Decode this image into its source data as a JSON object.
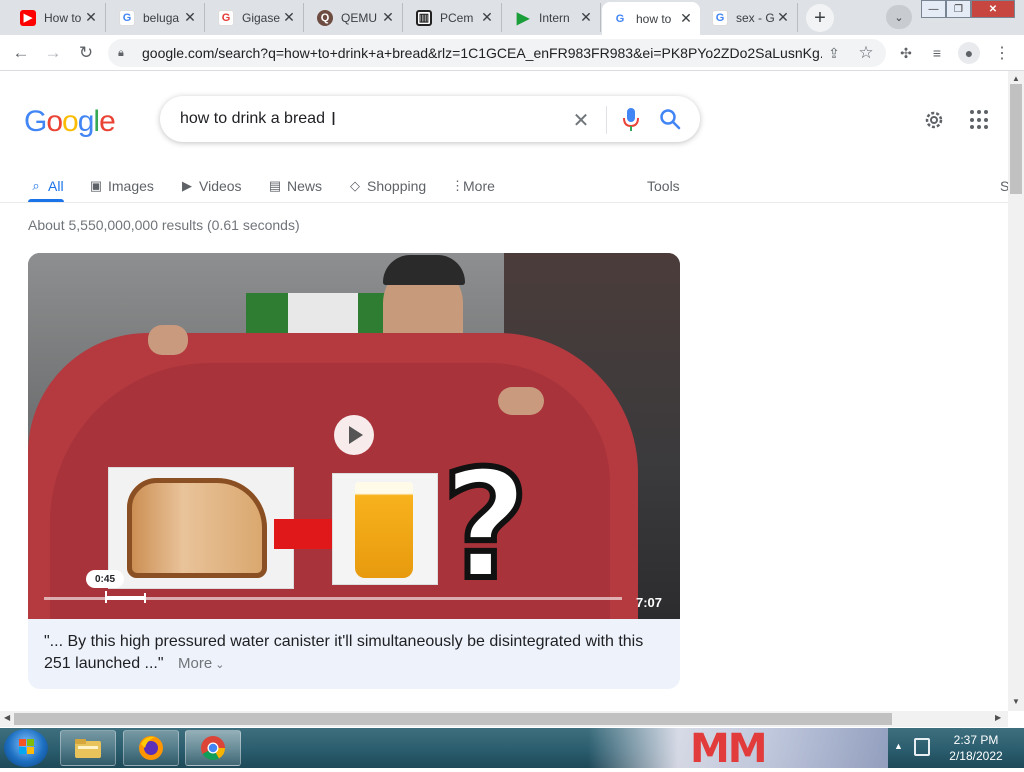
{
  "browser": {
    "tabs": [
      {
        "title": "How to",
        "favicon": "youtube-icon",
        "color": "#ff0000"
      },
      {
        "title": "beluga",
        "favicon": "google-icon",
        "color": "#4285f4"
      },
      {
        "title": "Gigase",
        "favicon": "google-icon-red",
        "color": "#e53935"
      },
      {
        "title": "QEMU",
        "favicon": "qemu-icon",
        "color": "#6d4c41"
      },
      {
        "title": "PCem",
        "favicon": "pcem-icon",
        "color": "#222222"
      },
      {
        "title": "Intern",
        "favicon": "play-icon",
        "color": "#1a9e3a"
      },
      {
        "title": "how to",
        "favicon": "google-icon",
        "color": "#4285f4"
      },
      {
        "title": "sex - G",
        "favicon": "google-icon",
        "color": "#4285f4"
      }
    ],
    "url": "google.com/search?q=how+to+drink+a+bread&rlz=1C1GCEA_enFR983FR983&ei=PK8PYo2ZDo2SaLusnKg..."
  },
  "search": {
    "logo": "Google",
    "query": "how to drink a bread",
    "tabs": [
      {
        "label": "All",
        "icon": "search-icon"
      },
      {
        "label": "Images",
        "icon": "image-icon"
      },
      {
        "label": "Videos",
        "icon": "video-icon"
      },
      {
        "label": "News",
        "icon": "news-icon"
      },
      {
        "label": "Shopping",
        "icon": "tag-icon"
      },
      {
        "label": "More",
        "icon": "dots-vertical-icon"
      }
    ],
    "tools": "Tools",
    "right_cut": "S",
    "stats": "About 5,550,000,000 results (0.61 seconds)"
  },
  "video": {
    "current_time": "0:45",
    "duration": "7:07",
    "progress_fraction": 0.105,
    "caption_line1": "\"... By this high pressured water canister it'll simultaneously be disintegrated with this",
    "caption_line2": "251 launched ...\"",
    "more": "More"
  },
  "taskbar": {
    "time": "2:37 PM",
    "date": "2/18/2022",
    "wallpaper_text": "MM"
  },
  "colors": {
    "accent": "#1a73e8",
    "google_blue": "#4285f4",
    "google_red": "#ea4335",
    "google_yellow": "#fbbc05",
    "google_green": "#34a853"
  }
}
